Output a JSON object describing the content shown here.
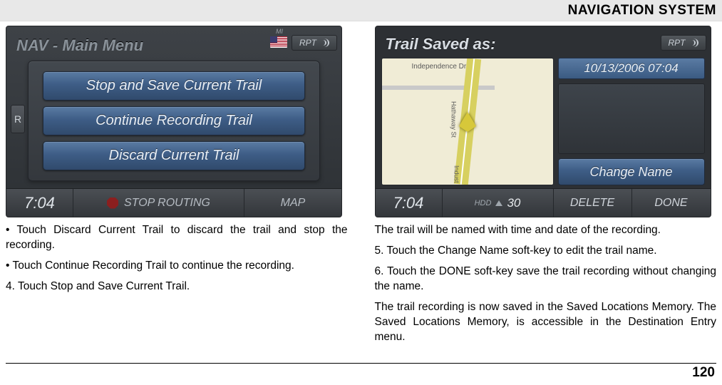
{
  "header": {
    "title": "NAVIGATION SYSTEM"
  },
  "page_number": "120",
  "left_screen": {
    "title": "NAV - Main Menu",
    "mi_label": "MI",
    "rpt_label": "RPT",
    "side_r": "R",
    "buttons": {
      "stop_save": "Stop and Save Current Trail",
      "continue": "Continue Recording Trail",
      "discard": "Discard Current Trail"
    },
    "footer": {
      "clock": "7:04",
      "stop_routing": "STOP ROUTING",
      "map": "MAP"
    }
  },
  "right_screen": {
    "title": "Trail Saved as:",
    "rpt_label": "RPT",
    "timestamp": "10/13/2006 07:04",
    "map_labels": {
      "independence": "Independence Dr",
      "hathaway": "Hathaway St",
      "indust": "Indust"
    },
    "change_name": "Change Name",
    "footer": {
      "clock": "7:04",
      "hdd_label": "HDD",
      "hdd_value": "30",
      "delete": "DELETE",
      "done": "DONE"
    }
  },
  "left_text": {
    "p1": "• Touch Discard Current Trail to discard the trail and stop the recording.",
    "p2": "• Touch Continue Recording Trail to continue the recording.",
    "p3": "4. Touch Stop and Save Current Trail."
  },
  "right_text": {
    "p1": "The trail will be named with time and date of the recording.",
    "p2": "5. Touch the Change Name soft-key to edit the trail name.",
    "p3": "6. Touch the DONE soft-key save the trail recording without changing the name.",
    "p4": "The trail recording is now saved in the Saved Locations Memory. The Saved Locations Memory, is accessible in the Destination Entry menu."
  }
}
